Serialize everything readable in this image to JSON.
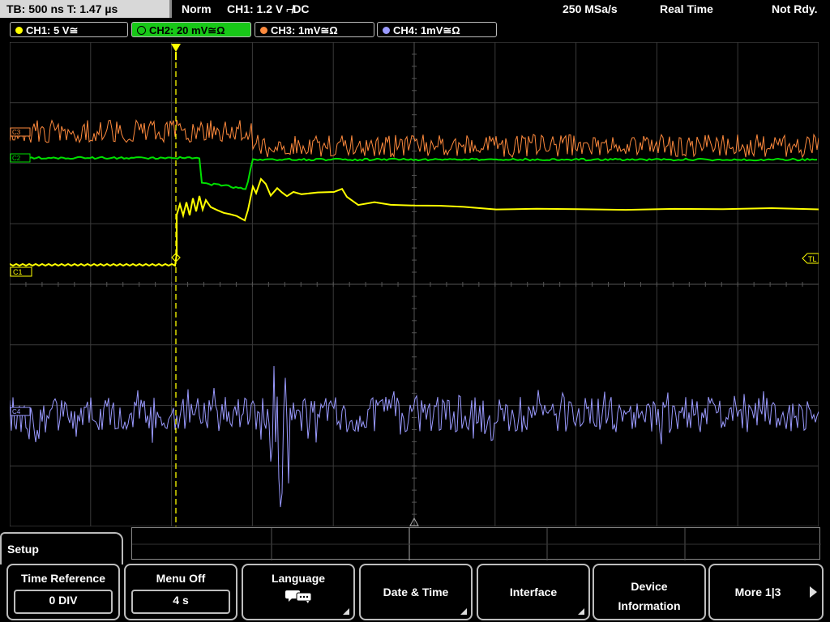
{
  "topbar": {
    "timebase": "TB: 500 ns   T: 1.47 µs",
    "mode": "Norm",
    "trigger": "CH1: 1.2 V ⌐̸DC",
    "samplerate": "250 MSa/s",
    "acq_mode": "Real Time",
    "status": "Not Rdy."
  },
  "channels": [
    {
      "label": "CH1: 5 V≅",
      "color": "#ffff00",
      "active": false
    },
    {
      "label": "CH2: 20 mV≅Ω",
      "color": "#00e000",
      "active": true
    },
    {
      "label": "CH3: 1mV≅Ω",
      "color": "#ff8a3d",
      "active": false
    },
    {
      "label": "CH4: 1mV≅Ω",
      "color": "#9a9aff",
      "active": false
    }
  ],
  "markers": {
    "c1": "C1",
    "tl": "TL",
    "c2": "C2",
    "c3": "C3",
    "c4": "C4"
  },
  "menu": {
    "title": "Setup",
    "softkeys": [
      {
        "label": "Time Reference",
        "value": "0 DIV"
      },
      {
        "label": "Menu Off",
        "value": "4 s"
      },
      {
        "label": "Language",
        "icon": "speech-bubbles-icon"
      },
      {
        "label": "Date & Time"
      },
      {
        "label": "Interface"
      },
      {
        "label1": "Device",
        "label2": "Information"
      },
      {
        "label": "More 1|3"
      }
    ]
  },
  "colors": {
    "ch1": "#ffff00",
    "ch2": "#00e000",
    "ch3": "#ff8a3d",
    "ch4": "#9a9aff",
    "grid": "#3a3a3a"
  }
}
